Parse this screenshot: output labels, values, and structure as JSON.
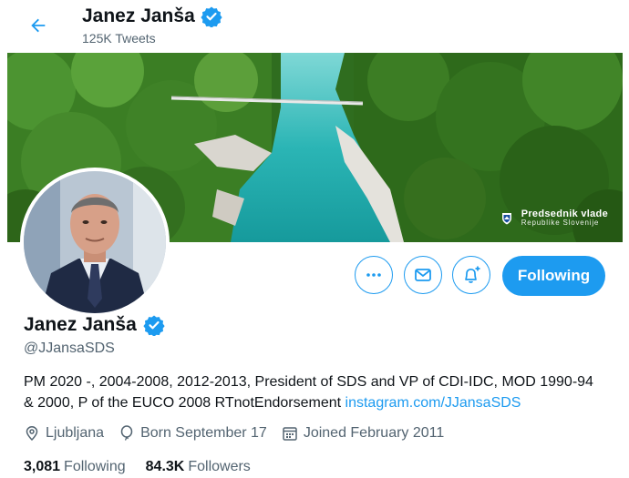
{
  "header": {
    "name": "Janez Janša",
    "tweets_count": "125K Tweets",
    "icons": {
      "back": "back-arrow-icon",
      "verified": "verified-badge-icon"
    }
  },
  "banner": {
    "caption_line1": "Predsednik vlade",
    "caption_line2": "Republike Slovenije",
    "caption_icon": "coat-of-arms-icon"
  },
  "actions": {
    "more_icon": "more-icon",
    "message_icon": "envelope-icon",
    "notify_icon": "bell-plus-icon",
    "follow_label": "Following",
    "accent": "#1d9bf0"
  },
  "profile": {
    "name": "Janez Janša",
    "handle": "@JJansaSDS",
    "bio_text": "PM 2020 -, 2004-2008, 2012-2013, President of SDS and VP of CDI-IDC, MOD 1990-94 & 2000, P of the EUCO 2008 RTnotEndorsement ",
    "bio_link": "instagram.com/JJansaSDS",
    "location": "Ljubljana",
    "born": "Born September 17",
    "joined": "Joined February 2011",
    "meta_icons": [
      "location-icon",
      "balloon-icon",
      "calendar-icon"
    ]
  },
  "stats": {
    "following_count": "3,081",
    "following_label": "Following",
    "followers_count": "84.3K",
    "followers_label": "Followers"
  },
  "colors": {
    "accent": "#1d9bf0",
    "text": "#0f1419",
    "secondary": "#536471"
  }
}
